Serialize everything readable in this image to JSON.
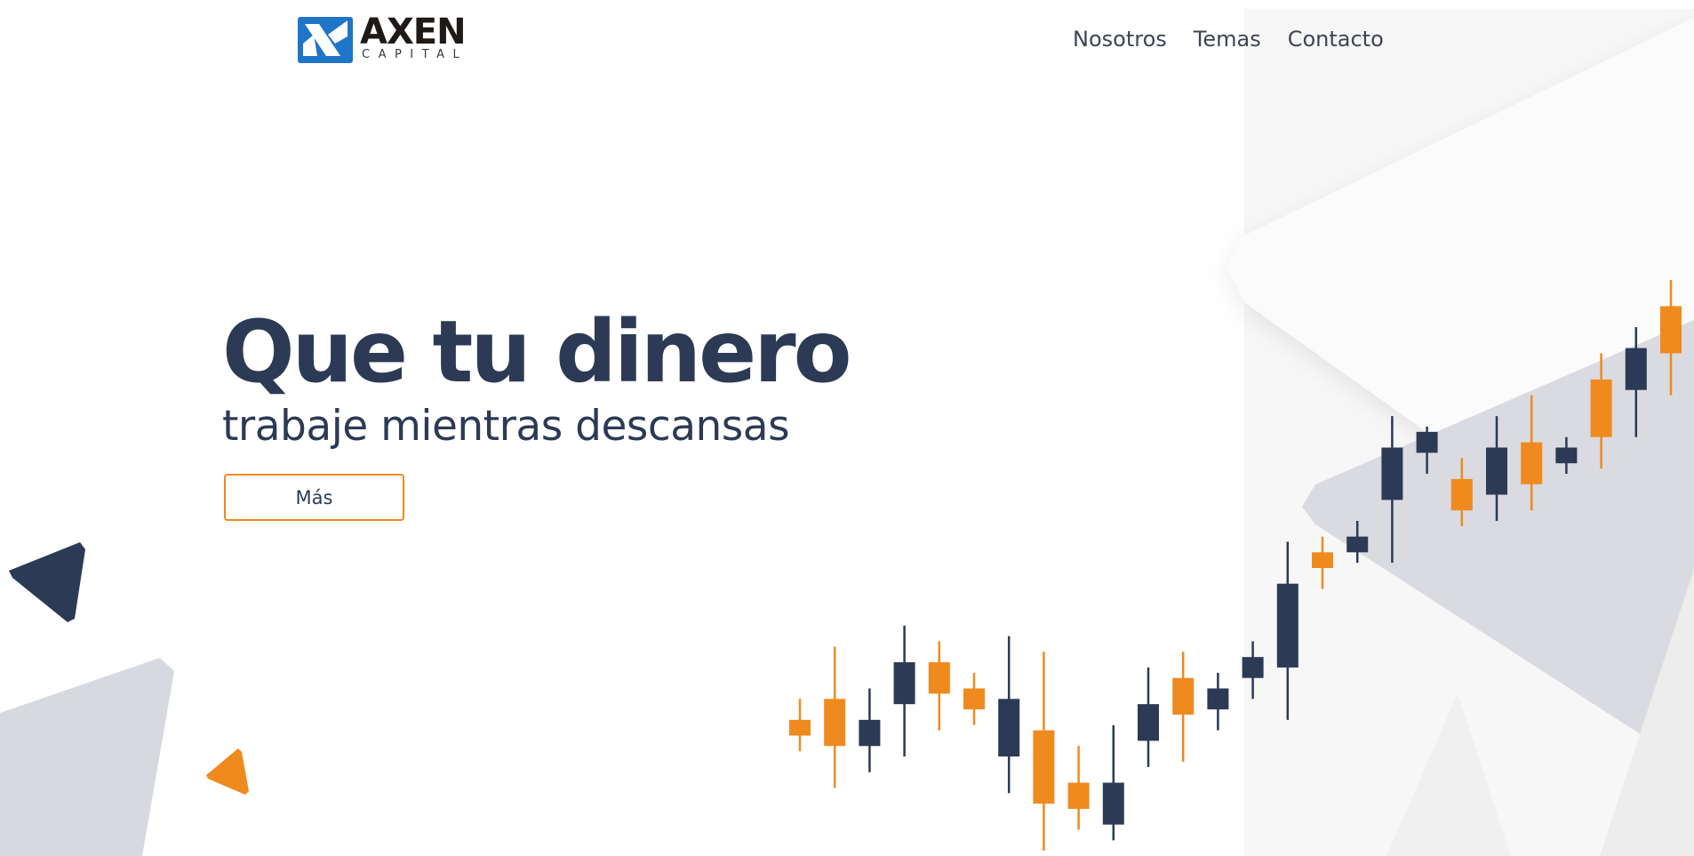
{
  "brand": {
    "name": "AXEN",
    "tagline": "CAPITAL",
    "colors": {
      "navy": "#2c3a55",
      "orange": "#ef8a1f",
      "blue": "#1f75c8"
    }
  },
  "nav": {
    "items": [
      {
        "label": "Nosotros"
      },
      {
        "label": "Temas"
      },
      {
        "label": "Contacto"
      }
    ]
  },
  "hero": {
    "title": "Que tu dinero",
    "subtitle": "trabaje mientras descansas",
    "button_label": "Más"
  },
  "decor": {
    "icons": [
      "logo-mark-icon",
      "navy-triangle-icon",
      "orange-triangle-icon",
      "gray-triangle-icon"
    ]
  },
  "chart_data": {
    "type": "candlestick",
    "title": "",
    "xlabel": "",
    "ylabel": "",
    "ylim": [
      0,
      100
    ],
    "candles": [
      {
        "color": "orange",
        "open": 23,
        "close": 26,
        "low": 20,
        "high": 30
      },
      {
        "color": "orange",
        "open": 21,
        "close": 30,
        "low": 13,
        "high": 40
      },
      {
        "color": "navy",
        "open": 26,
        "close": 21,
        "low": 16,
        "high": 32
      },
      {
        "color": "navy",
        "open": 37,
        "close": 29,
        "low": 19,
        "high": 44
      },
      {
        "color": "orange",
        "open": 31,
        "close": 37,
        "low": 24,
        "high": 41
      },
      {
        "color": "orange",
        "open": 28,
        "close": 32,
        "low": 25,
        "high": 35
      },
      {
        "color": "navy",
        "open": 30,
        "close": 19,
        "low": 12,
        "high": 42
      },
      {
        "color": "orange",
        "open": 10,
        "close": 24,
        "low": 1,
        "high": 39
      },
      {
        "color": "orange",
        "open": 9,
        "close": 14,
        "low": 5,
        "high": 21
      },
      {
        "color": "navy",
        "open": 14,
        "close": 6,
        "low": 3,
        "high": 25
      },
      {
        "color": "navy",
        "open": 29,
        "close": 22,
        "low": 17,
        "high": 36
      },
      {
        "color": "orange",
        "open": 27,
        "close": 34,
        "low": 18,
        "high": 39
      },
      {
        "color": "navy",
        "open": 32,
        "close": 28,
        "low": 24,
        "high": 35
      },
      {
        "color": "navy",
        "open": 38,
        "close": 34,
        "low": 30,
        "high": 41
      },
      {
        "color": "navy",
        "open": 52,
        "close": 36,
        "low": 26,
        "high": 60
      },
      {
        "color": "orange",
        "open": 55,
        "close": 58,
        "low": 51,
        "high": 61
      },
      {
        "color": "navy",
        "open": 58,
        "close": 61,
        "low": 56,
        "high": 64
      },
      {
        "color": "navy",
        "open": 68,
        "close": 78,
        "low": 56,
        "high": 84
      },
      {
        "color": "navy",
        "open": 77,
        "close": 81,
        "low": 73,
        "high": 82
      },
      {
        "color": "orange",
        "open": 66,
        "close": 72,
        "low": 63,
        "high": 76
      },
      {
        "color": "navy",
        "open": 69,
        "close": 78,
        "low": 64,
        "high": 84
      },
      {
        "color": "orange",
        "open": 71,
        "close": 79,
        "low": 66,
        "high": 88
      },
      {
        "color": "navy",
        "open": 78,
        "close": 75,
        "low": 73,
        "high": 80
      },
      {
        "color": "orange",
        "open": 80,
        "close": 91,
        "low": 74,
        "high": 96
      },
      {
        "color": "navy",
        "open": 89,
        "close": 97,
        "low": 80,
        "high": 101
      },
      {
        "color": "orange",
        "open": 96,
        "close": 105,
        "low": 88,
        "high": 110
      }
    ]
  }
}
